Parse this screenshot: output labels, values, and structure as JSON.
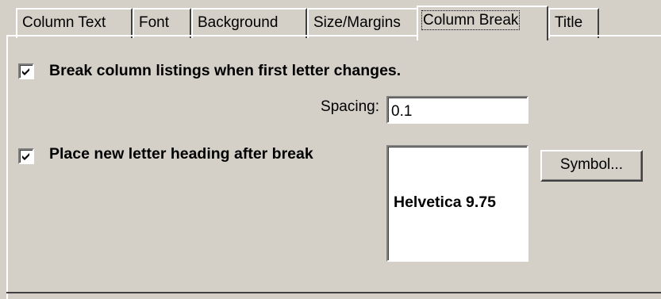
{
  "tabs": [
    {
      "label": "Column Text"
    },
    {
      "label": "Font"
    },
    {
      "label": "Background"
    },
    {
      "label": "Size/Margins"
    },
    {
      "label": "Column Break",
      "active": true
    },
    {
      "label": "Title"
    }
  ],
  "break_listings": {
    "checked": true,
    "label": "Break column listings when first letter changes."
  },
  "spacing": {
    "label": "Spacing:",
    "value": "0.1"
  },
  "letter_heading": {
    "checked": true,
    "label": "Place new letter heading after break"
  },
  "font_preview": {
    "text": "Helvetica  9.75"
  },
  "symbol_button": {
    "label": "Symbol..."
  }
}
